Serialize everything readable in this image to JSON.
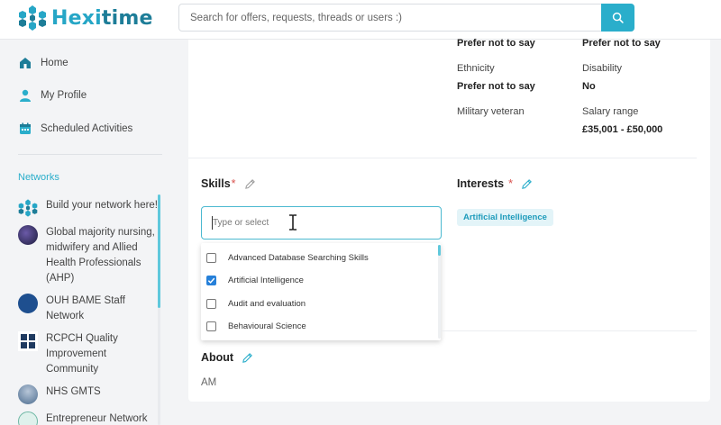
{
  "header": {
    "logo_prefix": "Hexi",
    "logo_suffix": "time",
    "search_placeholder": "Search for offers, requests, threads or users :)"
  },
  "sidebar": {
    "nav": [
      {
        "label": "Home",
        "icon": "home-icon"
      },
      {
        "label": "My Profile",
        "icon": "user-icon"
      },
      {
        "label": "Scheduled Activities",
        "icon": "calendar-icon"
      }
    ],
    "networks_title": "Networks",
    "networks": [
      {
        "label": "Build your network here!",
        "icon": "hexitime-logo-icon"
      },
      {
        "label": "Global majority nursing, midwifery and Allied Health Professionals (AHP)",
        "icon": "network-avatar-icon"
      },
      {
        "label": "OUH BAME Staff Network",
        "icon": "ouh-bame-logo-icon"
      },
      {
        "label": "RCPCH Quality Improvement Community",
        "icon": "rcpch-logo-icon"
      },
      {
        "label": "NHS GMTS",
        "icon": "nhs-gmts-avatar-icon"
      },
      {
        "label": "Entrepreneur Network",
        "icon": "entrepreneur-avatar-icon"
      }
    ]
  },
  "profile": {
    "top_left_value": "Prefer not to say",
    "top_right_value": "Prefer not to say",
    "ethnicity_label": "Ethnicity",
    "ethnicity_value": "Prefer not to say",
    "disability_label": "Disability",
    "disability_value": "No",
    "veteran_label": "Military veteran",
    "salary_label": "Salary range",
    "salary_value": "£35,001 - £50,000"
  },
  "skills": {
    "title": "Skills",
    "required_mark": "*",
    "input_placeholder": "Type or select",
    "options": [
      {
        "label": "Advanced Database Searching Skills",
        "checked": false
      },
      {
        "label": "Artificial Intelligence",
        "checked": true
      },
      {
        "label": "Audit and evaluation",
        "checked": false
      },
      {
        "label": "Behavioural Science",
        "checked": false
      }
    ]
  },
  "interests": {
    "title": "Interests",
    "required_mark": "*",
    "tags": [
      "Artificial Intelligence"
    ]
  },
  "about": {
    "title": "About",
    "value": "AM"
  },
  "colors": {
    "accent": "#2aaecb",
    "checkbox_checked": "#2680d9",
    "required": "#d9534f"
  }
}
